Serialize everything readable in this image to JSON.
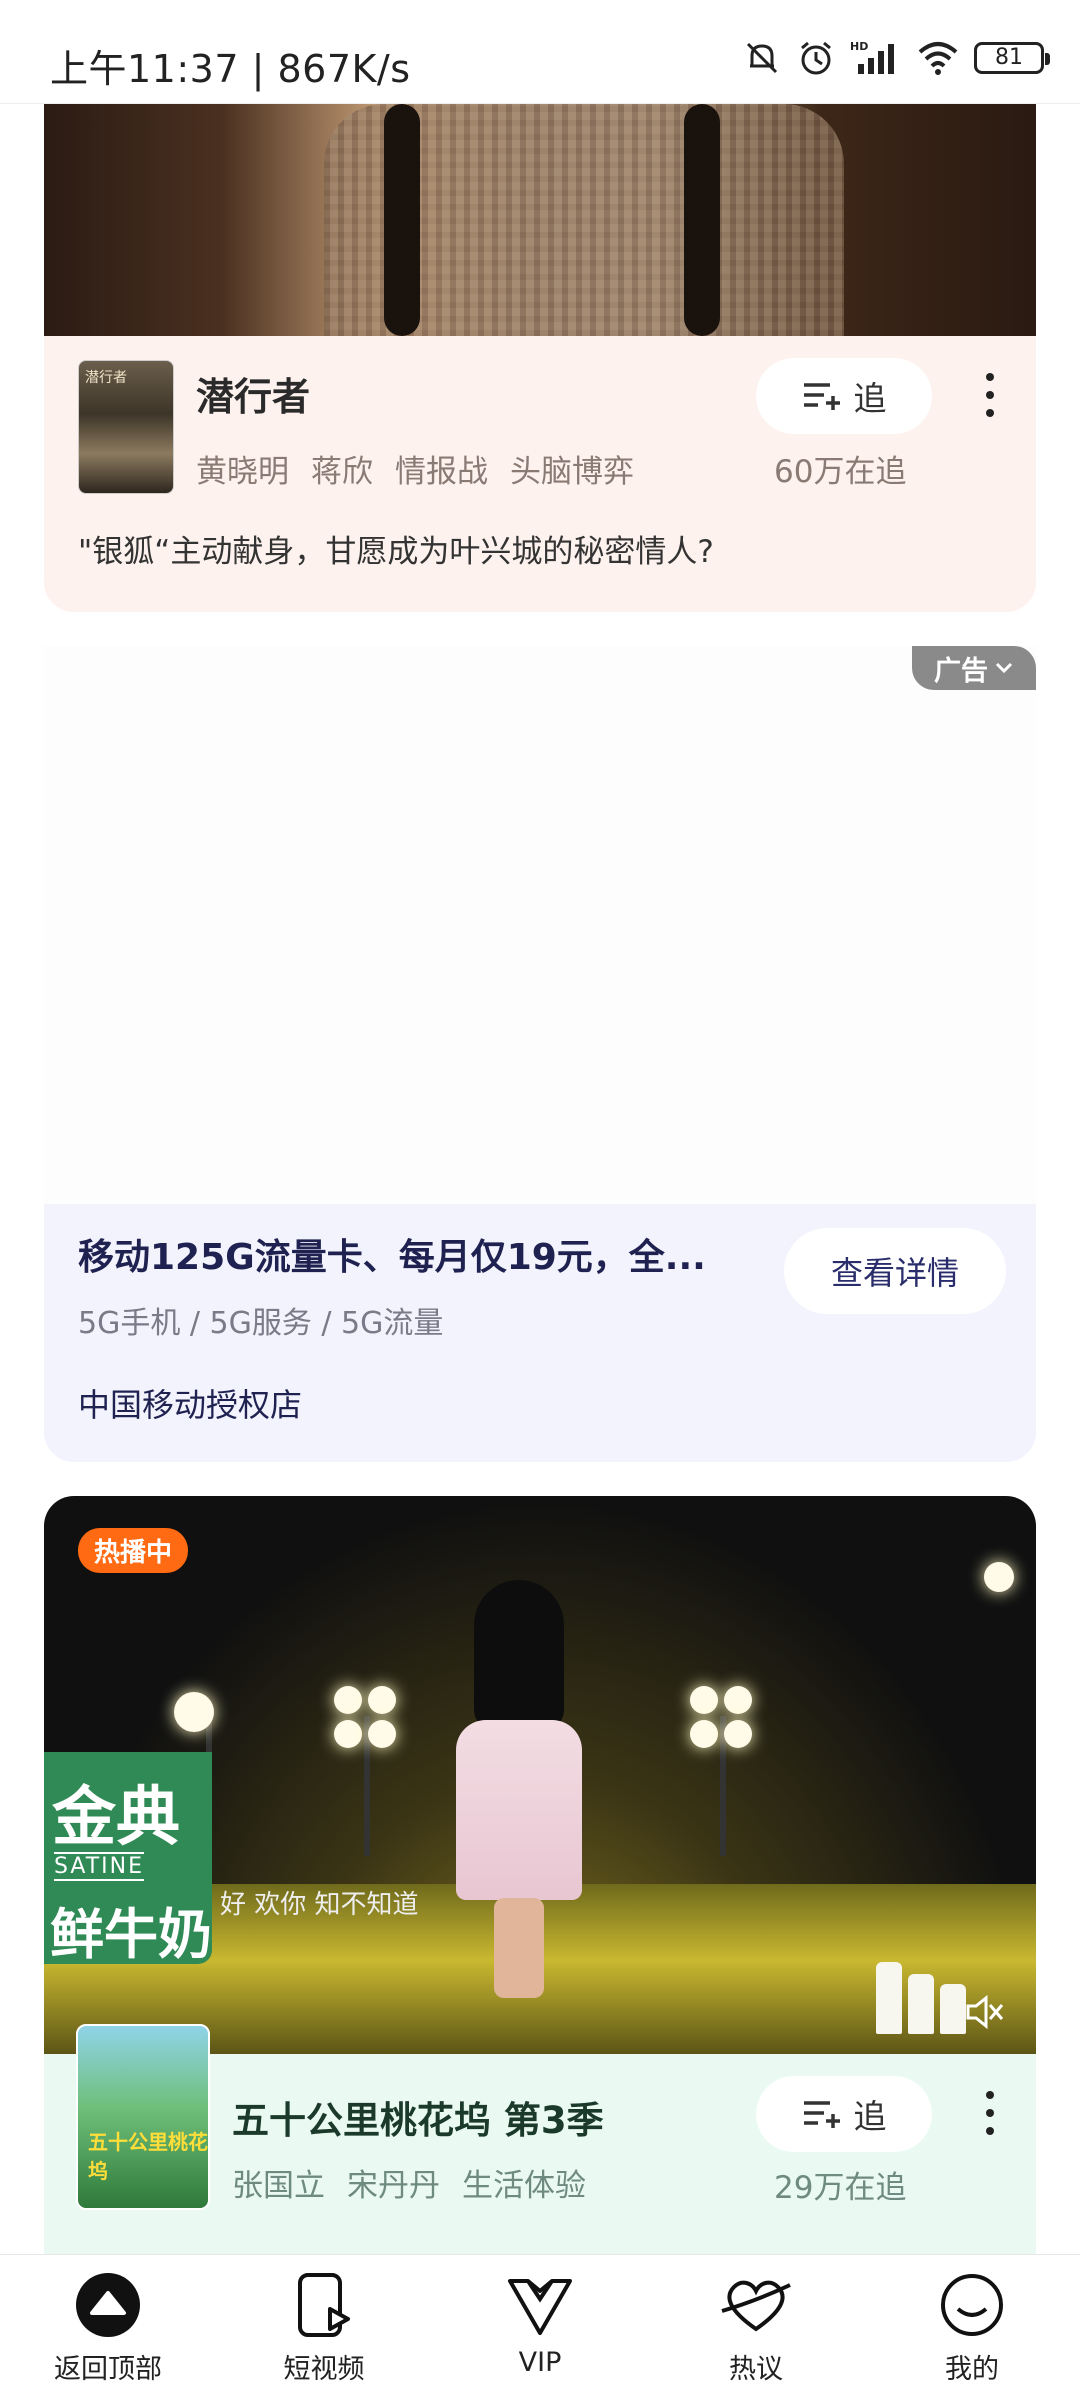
{
  "status_bar": {
    "time": "上午11:37 | 867K/s",
    "battery": "81"
  },
  "shows": [
    {
      "title": "潜行者",
      "tags": [
        "黄晓明",
        "蒋欣",
        "情报战",
        "头脑博弈"
      ],
      "follow_label": "追",
      "follow_count": "60万在追",
      "description": "\"银狐“主动献身，甘愿成为叶兴城的秘密情人?",
      "poster_text": "潜行者"
    },
    {
      "title": "五十公里桃花坞 第3季",
      "tags": [
        "张国立",
        "宋丹丹",
        "生活体验"
      ],
      "follow_label": "追",
      "follow_count": "29万在追",
      "badge": "热播中",
      "poster_text": "五十公里桃花坞",
      "sponsor_brand": "金典",
      "sponsor_sub": "SATINE",
      "sponsor_brand2": "鲜牛奶",
      "lyric": "好  欢你  知不知道"
    }
  ],
  "ad": {
    "badge": "广告",
    "title": "移动125G流量卡、每月仅19元，全...",
    "subtitle": "5G手机 / 5G服务 / 5G流量",
    "store": "中国移动授权店",
    "button": "查看详情"
  },
  "bottom_nav": [
    {
      "label": "返回顶部",
      "icon": "back-to-top-icon"
    },
    {
      "label": "短视频",
      "icon": "short-video-icon"
    },
    {
      "label": "VIP",
      "icon": "vip-icon"
    },
    {
      "label": "热议",
      "icon": "hot-discussion-icon"
    },
    {
      "label": "我的",
      "icon": "profile-icon"
    }
  ],
  "colors": {
    "hot_badge": "#ff6a13",
    "card1_bg": "#fdf2ee",
    "ad_bg": "#f3f3fd",
    "card3_bg": "#eafaf3"
  }
}
